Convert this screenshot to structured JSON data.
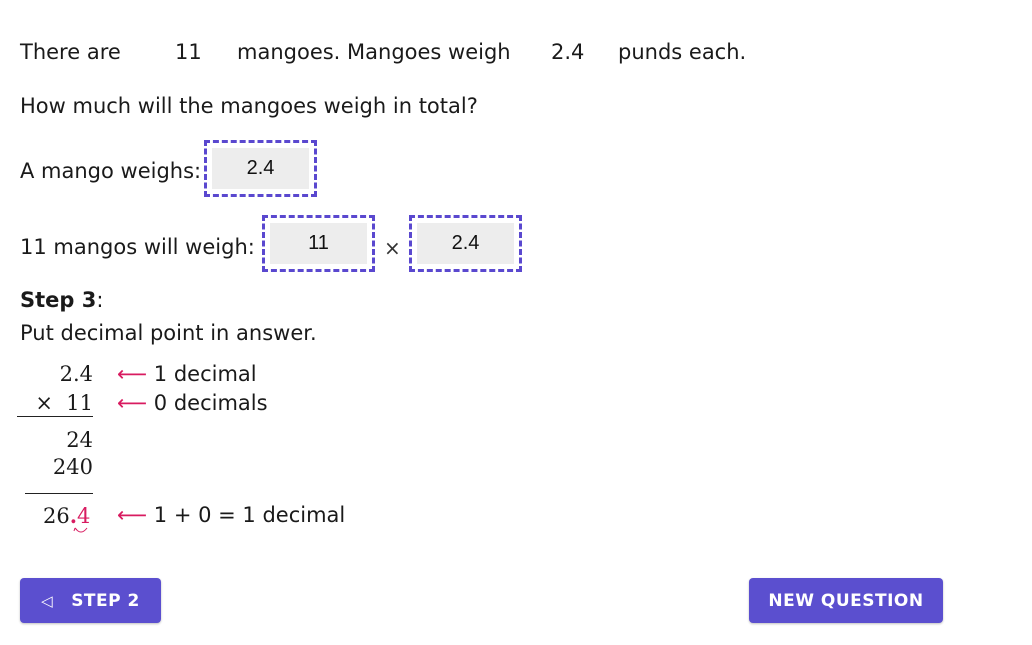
{
  "problem": {
    "sentence_part1": "There are",
    "count": "11",
    "sentence_part2": "mangoes. Mangoes weigh",
    "weight": "2.4",
    "sentence_part3": "punds each.",
    "question": "How much will the mangoes weigh in total?"
  },
  "inputs": {
    "mango_weighs_label": "A mango weighs:",
    "mango_weighs_value": "2.4",
    "total_label": "11 mangos will weigh:",
    "factor1_value": "11",
    "times_symbol": "×",
    "factor2_value": "2.4"
  },
  "step": {
    "title": "Step 3",
    "colon": ":",
    "instruction": "Put decimal point in answer."
  },
  "work": {
    "multiplicand": "2.4",
    "multiplier_line": "×  11",
    "partial1": "24",
    "partial2": "240",
    "result_whole": "26",
    "result_dot": ".",
    "result_decimal": "4",
    "arrow": "⟵",
    "note1": "1 decimal",
    "note2": "0 decimals",
    "note3": "1 + 0 = 1 decimal"
  },
  "buttons": {
    "prev_icon": "◁",
    "prev_label": "STEP 2",
    "new_question_label": "NEW QUESTION"
  },
  "colors": {
    "accent": "#5b4fcf",
    "dashed_border": "#5a48cf",
    "highlight": "#d81b60",
    "input_bg": "#ededed"
  }
}
